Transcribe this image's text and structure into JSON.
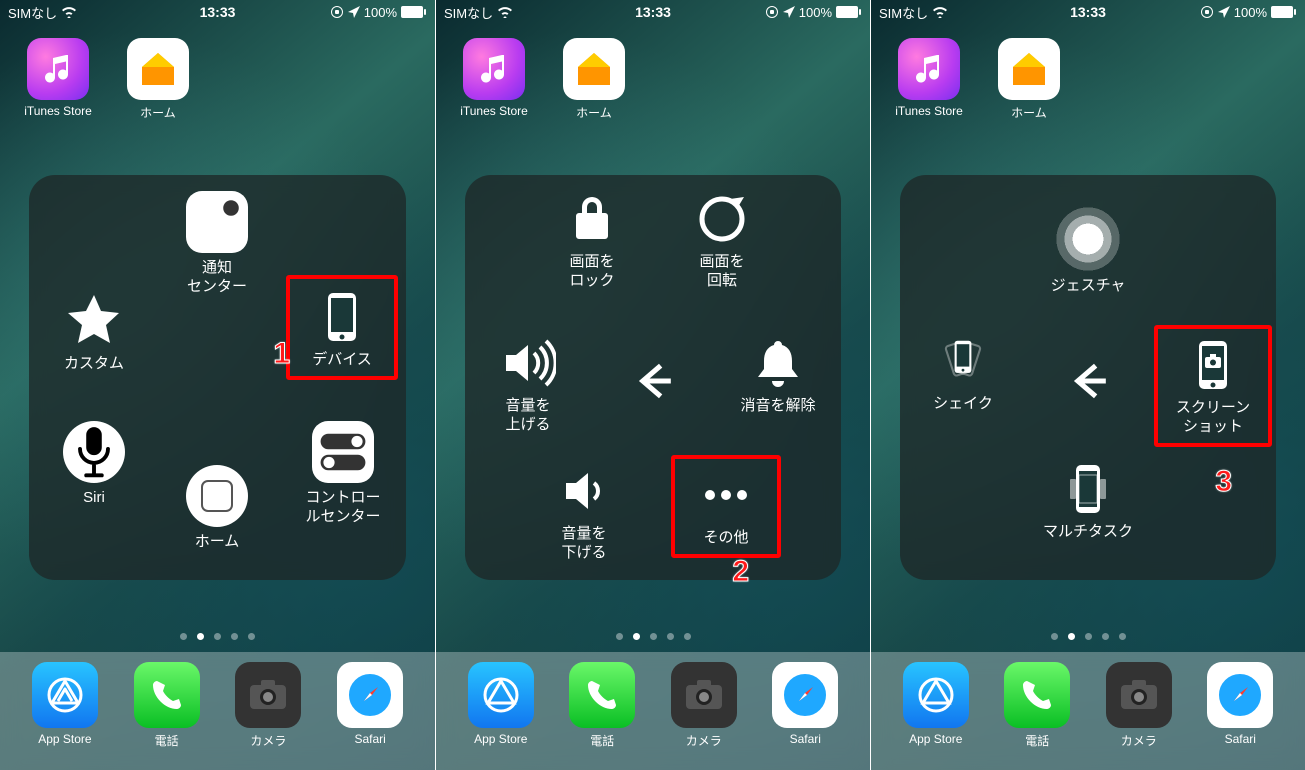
{
  "status": {
    "carrier": "SIMなし",
    "time": "13:33",
    "battery": "100%"
  },
  "homeApps": {
    "itunes": "iTunes Store",
    "home": "ホーム"
  },
  "dock": {
    "appstore": "App Store",
    "phone": "電話",
    "camera": "カメラ",
    "safari": "Safari"
  },
  "panel1": {
    "notification": "通知\nセンター",
    "custom": "カスタム",
    "device": "デバイス",
    "siri": "Siri",
    "home": "ホーム",
    "control": "コントロー\nルセンター",
    "step": "1"
  },
  "panel2": {
    "lock": "画面を\nロック",
    "rotate": "画面を\n回転",
    "volup": "音量を\n上げる",
    "mute": "消音を解除",
    "voldown": "音量を\n下げる",
    "more": "その他",
    "step": "2"
  },
  "panel3": {
    "gesture": "ジェスチャ",
    "shake": "シェイク",
    "screenshot": "スクリーン\nショット",
    "multitask": "マルチタスク",
    "step": "3"
  }
}
